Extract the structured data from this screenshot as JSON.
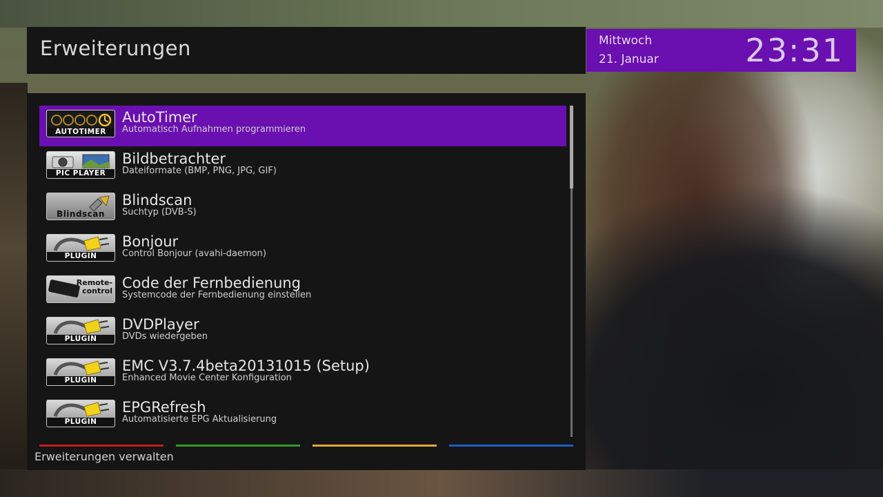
{
  "header": {
    "title": "Erweiterungen"
  },
  "clock": {
    "day": "Mittwoch",
    "date": "21. Januar",
    "time": "23:31"
  },
  "list": {
    "items": [
      {
        "title": "AutoTimer",
        "subtitle": "Automatisch Aufnahmen programmieren",
        "icon": "autotimer-icon",
        "icon_caption": "AUTOTIMER",
        "selected": true
      },
      {
        "title": "Bildbetrachter",
        "subtitle": "Dateiformate (BMP, PNG, JPG, GIF)",
        "icon": "pic-player-icon",
        "icon_caption": "PIC PLAYER",
        "selected": false
      },
      {
        "title": "Blindscan",
        "subtitle": "Suchtyp (DVB-S)",
        "icon": "blindscan-icon",
        "icon_caption": "Blindscan",
        "selected": false
      },
      {
        "title": "Bonjour",
        "subtitle": "Control Bonjour (avahi-daemon)",
        "icon": "plugin-icon",
        "icon_caption": "PLUGIN",
        "selected": false
      },
      {
        "title": "Code der Fernbedienung",
        "subtitle": "Systemcode der Fernbedienung einstellen",
        "icon": "remote-control-icon",
        "icon_caption": "Remote-\ncontrol",
        "selected": false
      },
      {
        "title": "DVDPlayer",
        "subtitle": "DVDs wiedergeben",
        "icon": "plugin-icon",
        "icon_caption": "PLUGIN",
        "selected": false
      },
      {
        "title": "EMC V3.7.4beta20131015 (Setup)",
        "subtitle": "Enhanced Movie Center Konfiguration",
        "icon": "plugin-icon",
        "icon_caption": "PLUGIN",
        "selected": false
      },
      {
        "title": "EPGRefresh",
        "subtitle": "Automatisierte EPG Aktualisierung",
        "icon": "plugin-icon",
        "icon_caption": "PLUGIN",
        "selected": false
      }
    ]
  },
  "color_keys": {
    "red": "#c41c1c",
    "green": "#2f9a2a",
    "yellow": "#e0a83a",
    "blue": "#1e5fc2"
  },
  "footer": {
    "label": "Erweiterungen verwalten"
  },
  "colors": {
    "accent": "#6a0fb0",
    "panel": "#151515"
  }
}
